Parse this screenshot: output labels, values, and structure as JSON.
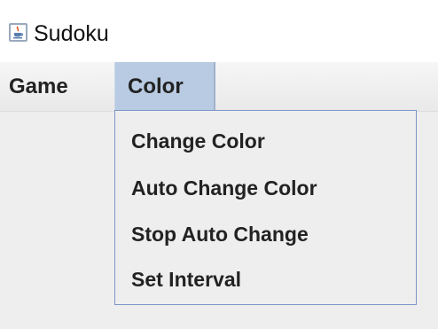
{
  "window": {
    "title": "Sudoku",
    "icon": "java-cup-icon"
  },
  "menubar": {
    "items": [
      {
        "label": "Game"
      },
      {
        "label": "Color",
        "active": true
      }
    ]
  },
  "color_menu": {
    "items": [
      {
        "label": "Change Color"
      },
      {
        "label": "Auto Change Color"
      },
      {
        "label": "Stop Auto Change"
      },
      {
        "label": "Set Interval"
      }
    ]
  },
  "colors": {
    "active_menu_bg": "#b9cbe2",
    "dropdown_border": "#7a95c8",
    "background": "#eeeeee"
  }
}
